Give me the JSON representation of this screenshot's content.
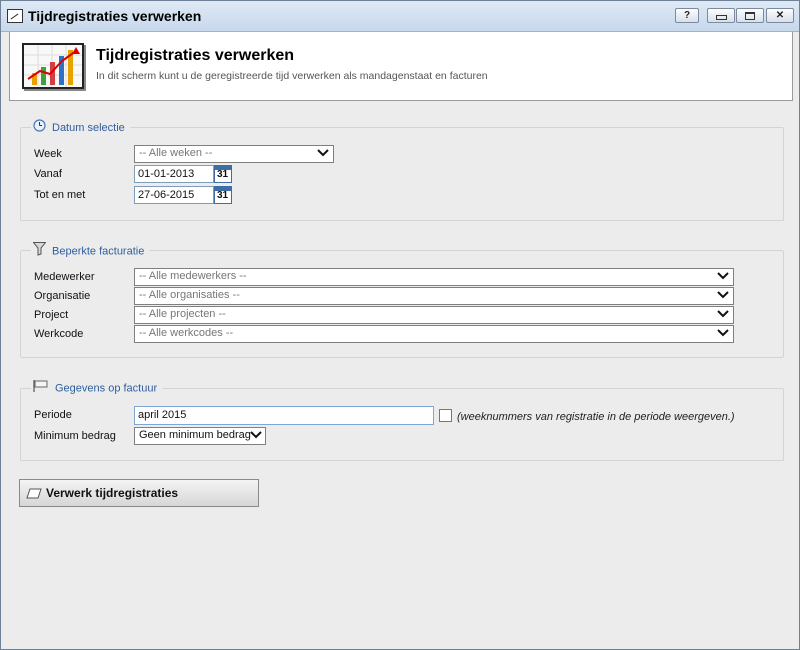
{
  "window": {
    "title": "Tijdregistraties verwerken",
    "help_label": "?"
  },
  "header": {
    "title": "Tijdregistraties verwerken",
    "subtitle": "In dit scherm kunt u de geregistreerde tijd verwerken als mandagenstaat en facturen",
    "logo_icon": "chart-icon"
  },
  "datum": {
    "legend": "Datum selectie",
    "icon": "clock-icon",
    "week_label": "Week",
    "week_value": "-- Alle weken --",
    "vanaf_label": "Vanaf",
    "vanaf_value": "01-01-2013",
    "totenmet_label": "Tot en met",
    "totenmet_value": "27-06-2015",
    "calendar_text": "31"
  },
  "facturatie": {
    "legend": "Beperkte facturatie",
    "icon": "filter-icon",
    "fields": [
      {
        "label": "Medewerker",
        "value": "-- Alle medewerkers --"
      },
      {
        "label": "Organisatie",
        "value": "-- Alle organisaties --"
      },
      {
        "label": "Project",
        "value": "-- Alle projecten --"
      },
      {
        "label": "Werkcode",
        "value": "-- Alle werkcodes --"
      }
    ]
  },
  "factuur": {
    "legend": "Gegevens op factuur",
    "icon": "invoice-flag-icon",
    "periode_label": "Periode",
    "periode_value": "april 2015",
    "weeknummers_note": "(weeknummers van registratie in de periode weergeven.)",
    "weeknummers_checked": false,
    "minimum_label": "Minimum bedrag",
    "minimum_value": "Geen minimum bedrag"
  },
  "actions": {
    "process_label": "Verwerk tijdregistraties",
    "process_icon": "eraser-icon"
  },
  "colors": {
    "accent": "#2d5e9e",
    "titlebar": "#c7d8ec"
  }
}
